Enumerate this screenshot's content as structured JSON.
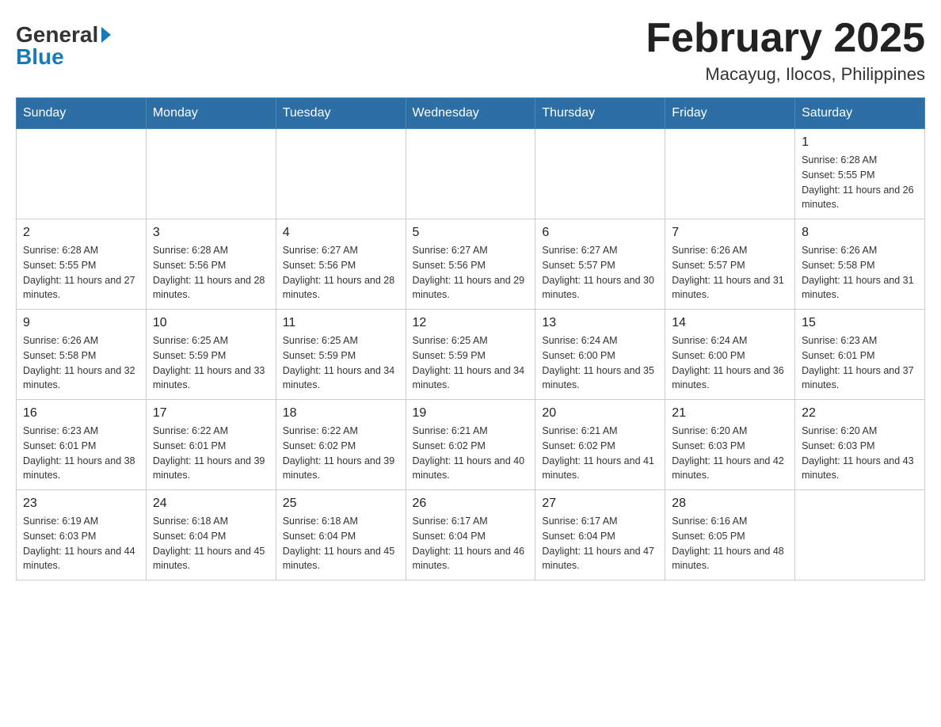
{
  "logo": {
    "general": "General",
    "blue": "Blue"
  },
  "title": "February 2025",
  "location": "Macayug, Ilocos, Philippines",
  "days_of_week": [
    "Sunday",
    "Monday",
    "Tuesday",
    "Wednesday",
    "Thursday",
    "Friday",
    "Saturday"
  ],
  "weeks": [
    [
      {
        "day": "",
        "info": ""
      },
      {
        "day": "",
        "info": ""
      },
      {
        "day": "",
        "info": ""
      },
      {
        "day": "",
        "info": ""
      },
      {
        "day": "",
        "info": ""
      },
      {
        "day": "",
        "info": ""
      },
      {
        "day": "1",
        "info": "Sunrise: 6:28 AM\nSunset: 5:55 PM\nDaylight: 11 hours and 26 minutes."
      }
    ],
    [
      {
        "day": "2",
        "info": "Sunrise: 6:28 AM\nSunset: 5:55 PM\nDaylight: 11 hours and 27 minutes."
      },
      {
        "day": "3",
        "info": "Sunrise: 6:28 AM\nSunset: 5:56 PM\nDaylight: 11 hours and 28 minutes."
      },
      {
        "day": "4",
        "info": "Sunrise: 6:27 AM\nSunset: 5:56 PM\nDaylight: 11 hours and 28 minutes."
      },
      {
        "day": "5",
        "info": "Sunrise: 6:27 AM\nSunset: 5:56 PM\nDaylight: 11 hours and 29 minutes."
      },
      {
        "day": "6",
        "info": "Sunrise: 6:27 AM\nSunset: 5:57 PM\nDaylight: 11 hours and 30 minutes."
      },
      {
        "day": "7",
        "info": "Sunrise: 6:26 AM\nSunset: 5:57 PM\nDaylight: 11 hours and 31 minutes."
      },
      {
        "day": "8",
        "info": "Sunrise: 6:26 AM\nSunset: 5:58 PM\nDaylight: 11 hours and 31 minutes."
      }
    ],
    [
      {
        "day": "9",
        "info": "Sunrise: 6:26 AM\nSunset: 5:58 PM\nDaylight: 11 hours and 32 minutes."
      },
      {
        "day": "10",
        "info": "Sunrise: 6:25 AM\nSunset: 5:59 PM\nDaylight: 11 hours and 33 minutes."
      },
      {
        "day": "11",
        "info": "Sunrise: 6:25 AM\nSunset: 5:59 PM\nDaylight: 11 hours and 34 minutes."
      },
      {
        "day": "12",
        "info": "Sunrise: 6:25 AM\nSunset: 5:59 PM\nDaylight: 11 hours and 34 minutes."
      },
      {
        "day": "13",
        "info": "Sunrise: 6:24 AM\nSunset: 6:00 PM\nDaylight: 11 hours and 35 minutes."
      },
      {
        "day": "14",
        "info": "Sunrise: 6:24 AM\nSunset: 6:00 PM\nDaylight: 11 hours and 36 minutes."
      },
      {
        "day": "15",
        "info": "Sunrise: 6:23 AM\nSunset: 6:01 PM\nDaylight: 11 hours and 37 minutes."
      }
    ],
    [
      {
        "day": "16",
        "info": "Sunrise: 6:23 AM\nSunset: 6:01 PM\nDaylight: 11 hours and 38 minutes."
      },
      {
        "day": "17",
        "info": "Sunrise: 6:22 AM\nSunset: 6:01 PM\nDaylight: 11 hours and 39 minutes."
      },
      {
        "day": "18",
        "info": "Sunrise: 6:22 AM\nSunset: 6:02 PM\nDaylight: 11 hours and 39 minutes."
      },
      {
        "day": "19",
        "info": "Sunrise: 6:21 AM\nSunset: 6:02 PM\nDaylight: 11 hours and 40 minutes."
      },
      {
        "day": "20",
        "info": "Sunrise: 6:21 AM\nSunset: 6:02 PM\nDaylight: 11 hours and 41 minutes."
      },
      {
        "day": "21",
        "info": "Sunrise: 6:20 AM\nSunset: 6:03 PM\nDaylight: 11 hours and 42 minutes."
      },
      {
        "day": "22",
        "info": "Sunrise: 6:20 AM\nSunset: 6:03 PM\nDaylight: 11 hours and 43 minutes."
      }
    ],
    [
      {
        "day": "23",
        "info": "Sunrise: 6:19 AM\nSunset: 6:03 PM\nDaylight: 11 hours and 44 minutes."
      },
      {
        "day": "24",
        "info": "Sunrise: 6:18 AM\nSunset: 6:04 PM\nDaylight: 11 hours and 45 minutes."
      },
      {
        "day": "25",
        "info": "Sunrise: 6:18 AM\nSunset: 6:04 PM\nDaylight: 11 hours and 45 minutes."
      },
      {
        "day": "26",
        "info": "Sunrise: 6:17 AM\nSunset: 6:04 PM\nDaylight: 11 hours and 46 minutes."
      },
      {
        "day": "27",
        "info": "Sunrise: 6:17 AM\nSunset: 6:04 PM\nDaylight: 11 hours and 47 minutes."
      },
      {
        "day": "28",
        "info": "Sunrise: 6:16 AM\nSunset: 6:05 PM\nDaylight: 11 hours and 48 minutes."
      },
      {
        "day": "",
        "info": ""
      }
    ]
  ]
}
